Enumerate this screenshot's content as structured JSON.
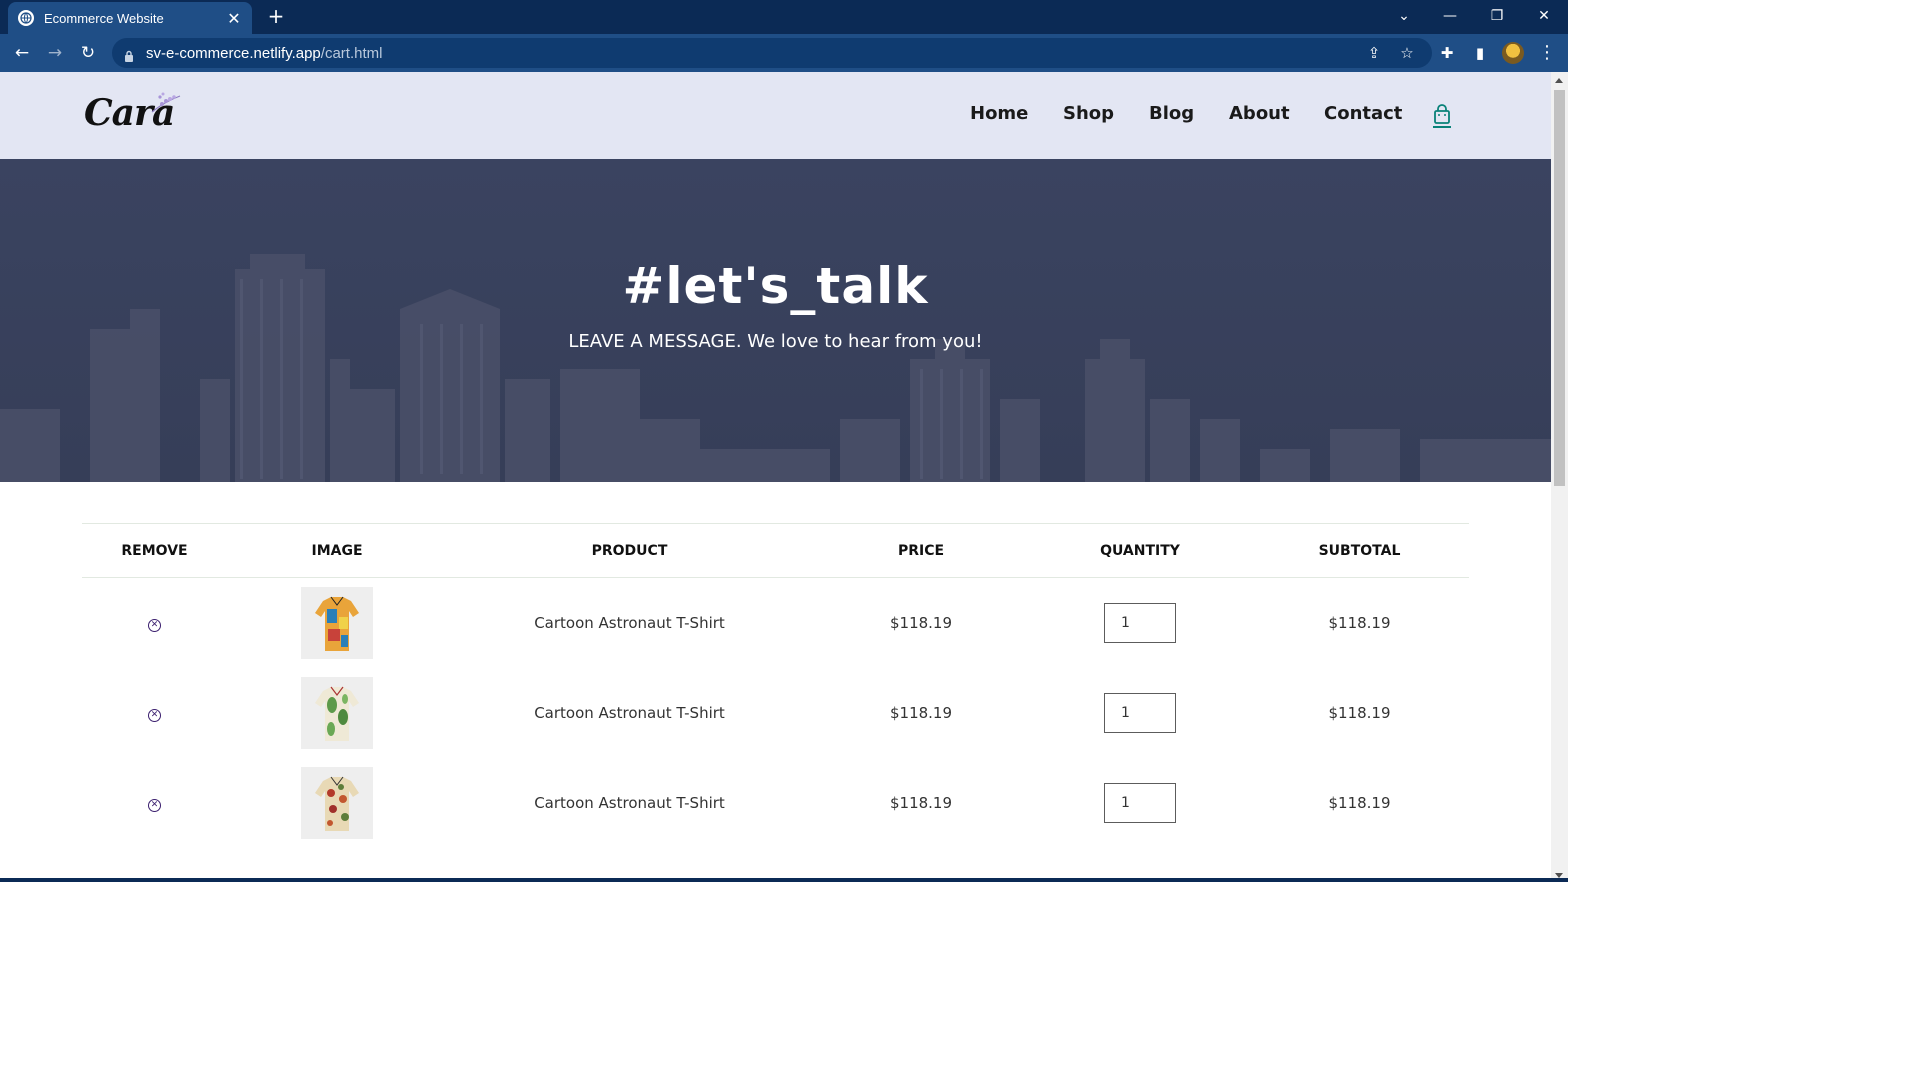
{
  "browser": {
    "tab_title": "Ecommerce Website",
    "close_symbol": "✕",
    "new_tab_symbol": "+",
    "url_host": "sv-e-commerce.netlify.app",
    "url_path": "/cart.html",
    "controls": {
      "tab_search": "⌄",
      "minimize": "—",
      "restore": "❐",
      "close": "✕"
    },
    "nav": {
      "back": "←",
      "forward": "→",
      "reload": "↻"
    },
    "omni_icons": {
      "share": "⇪",
      "bookmark": "☆",
      "extensions": "✚",
      "sidebar": "▮",
      "menu": "⋮"
    }
  },
  "site": {
    "logo_text": "Cara",
    "nav": [
      {
        "label": "Home"
      },
      {
        "label": "Shop"
      },
      {
        "label": "Blog"
      },
      {
        "label": "About"
      },
      {
        "label": "Contact"
      }
    ],
    "accent_color": "#088178"
  },
  "hero": {
    "heading": "#let's_talk",
    "subheading": "LEAVE A MESSAGE. We love to hear from you!"
  },
  "cart": {
    "headers": [
      "REMOVE",
      "IMAGE",
      "PRODUCT",
      "PRICE",
      "QUANTITY",
      "SUBTOTAL"
    ],
    "remove_symbol": "✕",
    "rows": [
      {
        "product": "Cartoon Astronaut T-Shirt",
        "price": "$118.19",
        "quantity": "1",
        "subtotal": "$118.19",
        "image": "colorful-shirt"
      },
      {
        "product": "Cartoon Astronaut T-Shirt",
        "price": "$118.19",
        "quantity": "1",
        "subtotal": "$118.19",
        "image": "leaf-print-shirt"
      },
      {
        "product": "Cartoon Astronaut T-Shirt",
        "price": "$118.19",
        "quantity": "1",
        "subtotal": "$118.19",
        "image": "floral-shirt"
      }
    ]
  }
}
